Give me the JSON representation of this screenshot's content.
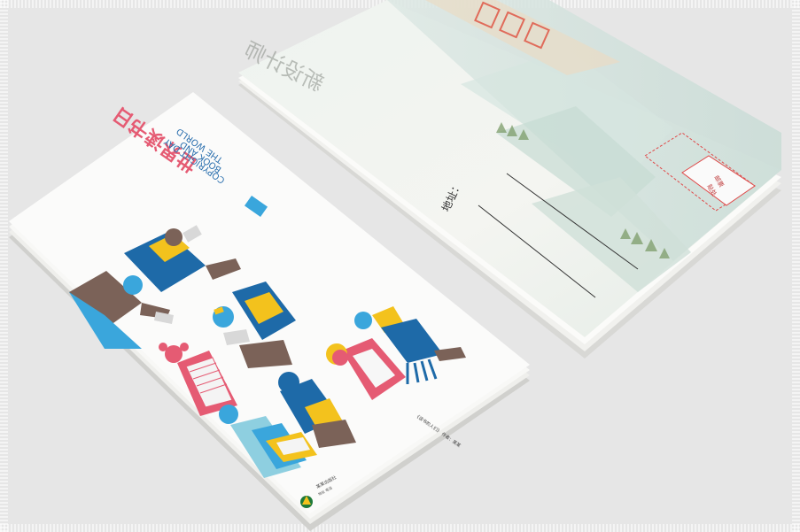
{
  "back_card": {
    "title": "新设计师",
    "field_label": "地址：",
    "stamp_line1": "邮票",
    "stamp_line2": "贴处",
    "colors": {
      "paper": "#f4f6f2",
      "mountain": "#dfe9e5",
      "stamp": "#e04848",
      "tree": "#6d8f5c"
    }
  },
  "front_card": {
    "title_cn": "世界读书日",
    "title_en_1": "THE WORLD",
    "title_en_2": "BOOK AND",
    "title_en_3": "COPYRIGHT DAY",
    "caption": "《读书的人们》 作者：某某",
    "publisher_1": "某某出版社",
    "publisher_2": "地址  电话",
    "colors": {
      "blue": "#1e6aa8",
      "sky": "#3aa6dc",
      "yellow": "#f3c21d",
      "pink": "#e55b73",
      "brown": "#7b6258",
      "light": "#8ecfe0"
    }
  }
}
